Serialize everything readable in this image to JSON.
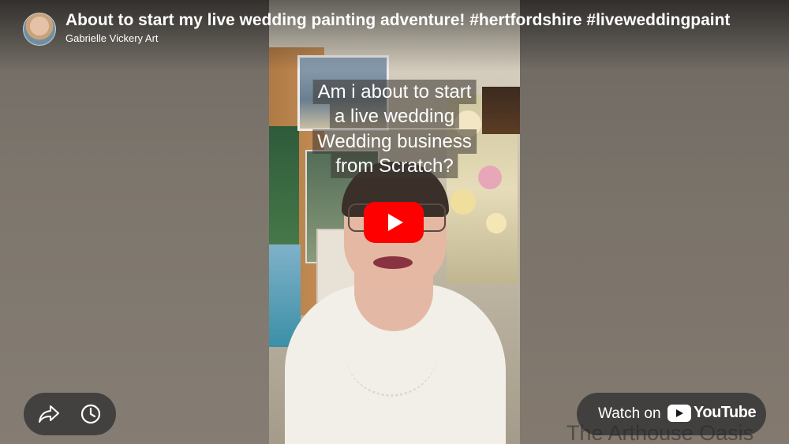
{
  "video": {
    "title": "About to start my live wedding painting adventure! #hertfordshire #liveweddingpaint",
    "channel": "Gabrielle Vickery Art",
    "overlay_lines": [
      "Am i about to start",
      "a live wedding",
      "Wedding business",
      "from Scratch?"
    ]
  },
  "controls": {
    "share_icon": "share-arrow-icon",
    "watch_later_icon": "clock-icon",
    "play_icon": "youtube-play-icon",
    "watch_on_label": "Watch on",
    "youtube_label": "YouTube"
  },
  "watermark": "The Arthouse Oasis",
  "colors": {
    "play_red": "#ff0000",
    "pill_bg": "#323232"
  }
}
